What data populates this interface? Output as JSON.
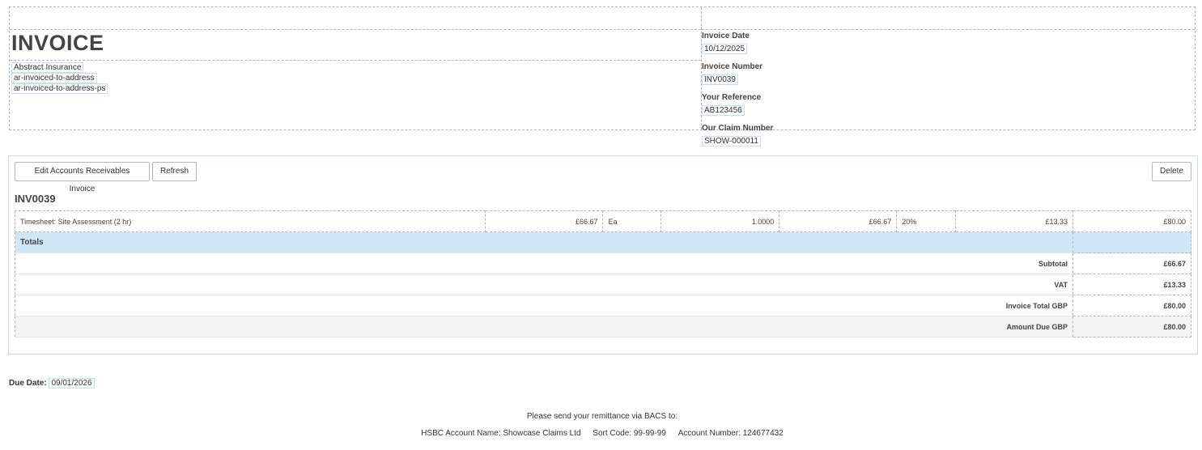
{
  "header": {
    "title": "INVOICE",
    "address": [
      "Abstract Insurance",
      "ar-invoiced-to-address",
      "ar-invoiced-to-address-ps"
    ],
    "meta": [
      {
        "label": "Invoice Date",
        "value": "10/12/2025"
      },
      {
        "label": "Invoice Number",
        "value": "INV0039"
      },
      {
        "label": "Your Reference",
        "value": "AB123456"
      },
      {
        "label": "Our Claim Number",
        "value": "SHOW-000011"
      }
    ]
  },
  "toolbar": {
    "edit_label": "Edit Accounts Receivables Invoice",
    "refresh_label": "Refresh",
    "delete_label": "Delete"
  },
  "invoice": {
    "heading": "INV0039",
    "line": {
      "description": "Timesheet: Site Assessment (2 hr)",
      "unit_price": "£66.67",
      "unit": "Ea",
      "quantity": "1.0000",
      "net": "£66.67",
      "vat_rate": "20%",
      "vat": "£13.33",
      "total": "£80.00"
    },
    "totals_label": "Totals",
    "totals": [
      {
        "label": "Subtotal",
        "value": "£66.67"
      },
      {
        "label": "VAT",
        "value": "£13.33"
      },
      {
        "label": "Invoice Total GBP",
        "value": "£80.00"
      },
      {
        "label": "Amount Due GBP",
        "value": "£80.00"
      }
    ]
  },
  "footer": {
    "due_label": "Due Date:",
    "due_value": "09/01/2026",
    "remit_text": "Please send your remittance via BACS to:",
    "bank_name": "HSBC Account Name: Showcase Claims Ltd",
    "sort_code": "Sort Code: 99-99-99",
    "account_number": "Account Number: 124677432"
  }
}
